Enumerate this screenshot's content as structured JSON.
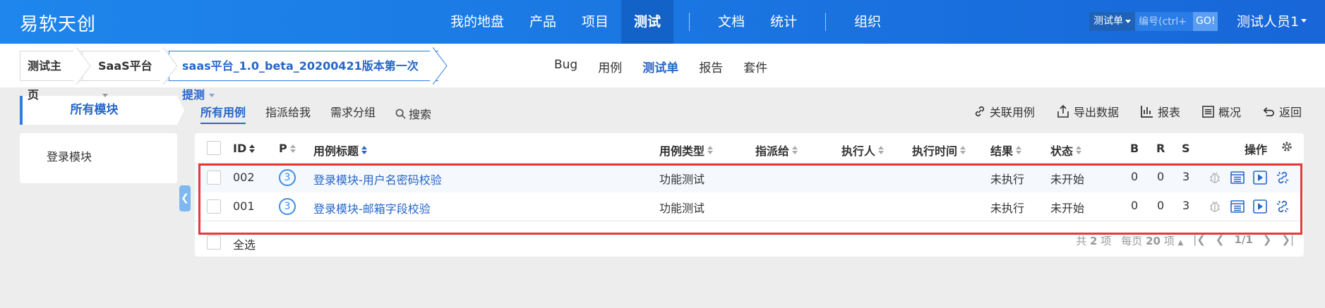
{
  "app": {
    "logo": "易软天创"
  },
  "nav": {
    "items": [
      "我的地盘",
      "产品",
      "项目",
      "测试",
      "文档",
      "统计",
      "组织"
    ],
    "active": "测试"
  },
  "search": {
    "type_label": "测试单",
    "placeholder": "编号(ctrl+",
    "go_label": "GO!"
  },
  "user": {
    "name": "测试人员1"
  },
  "breadcrumb": {
    "home": "测试主页",
    "platform": "SaaS平台",
    "testtask": "saas平台_1.0_beta_20200421版本第一次提测"
  },
  "subnav": {
    "items": [
      "Bug",
      "用例",
      "测试单",
      "报告",
      "套件"
    ],
    "active": "测试单"
  },
  "sidebar": {
    "header": "所有模块",
    "modules": [
      "登录模块"
    ]
  },
  "filters": {
    "items": [
      "所有用例",
      "指派给我",
      "需求分组"
    ],
    "search": "搜索"
  },
  "actions": {
    "link_case": "关联用例",
    "export": "导出数据",
    "report": "报表",
    "overview": "概况",
    "back": "返回"
  },
  "table": {
    "headers": {
      "id": "ID",
      "pri": "P",
      "title": "用例标题",
      "type": "用例类型",
      "assigned": "指派给",
      "executor": "执行人",
      "exec_time": "执行时间",
      "result": "结果",
      "status": "状态",
      "b": "B",
      "r": "R",
      "s": "S",
      "ops": "操作"
    },
    "rows": [
      {
        "id": "002",
        "pri": "3",
        "title": "登录模块-用户名密码校验",
        "type": "功能测试",
        "assigned": "",
        "executor": "",
        "exec_time": "",
        "result": "未执行",
        "status": "未开始",
        "b": "0",
        "r": "0",
        "s": "3"
      },
      {
        "id": "001",
        "pri": "3",
        "title": "登录模块-邮箱字段校验",
        "type": "功能测试",
        "assigned": "",
        "executor": "",
        "exec_time": "",
        "result": "未执行",
        "status": "未开始",
        "b": "0",
        "r": "0",
        "s": "3"
      }
    ]
  },
  "footer": {
    "select_all": "全选",
    "total_prefix": "共",
    "total": "2",
    "total_suffix": "项",
    "per_page_prefix": "每页",
    "per_page": "20",
    "per_page_suffix": "项",
    "page": "1/1"
  },
  "colors": {
    "brand": "#1a73e0",
    "accent": "#2667c8",
    "highlight": "#e53a3a"
  }
}
